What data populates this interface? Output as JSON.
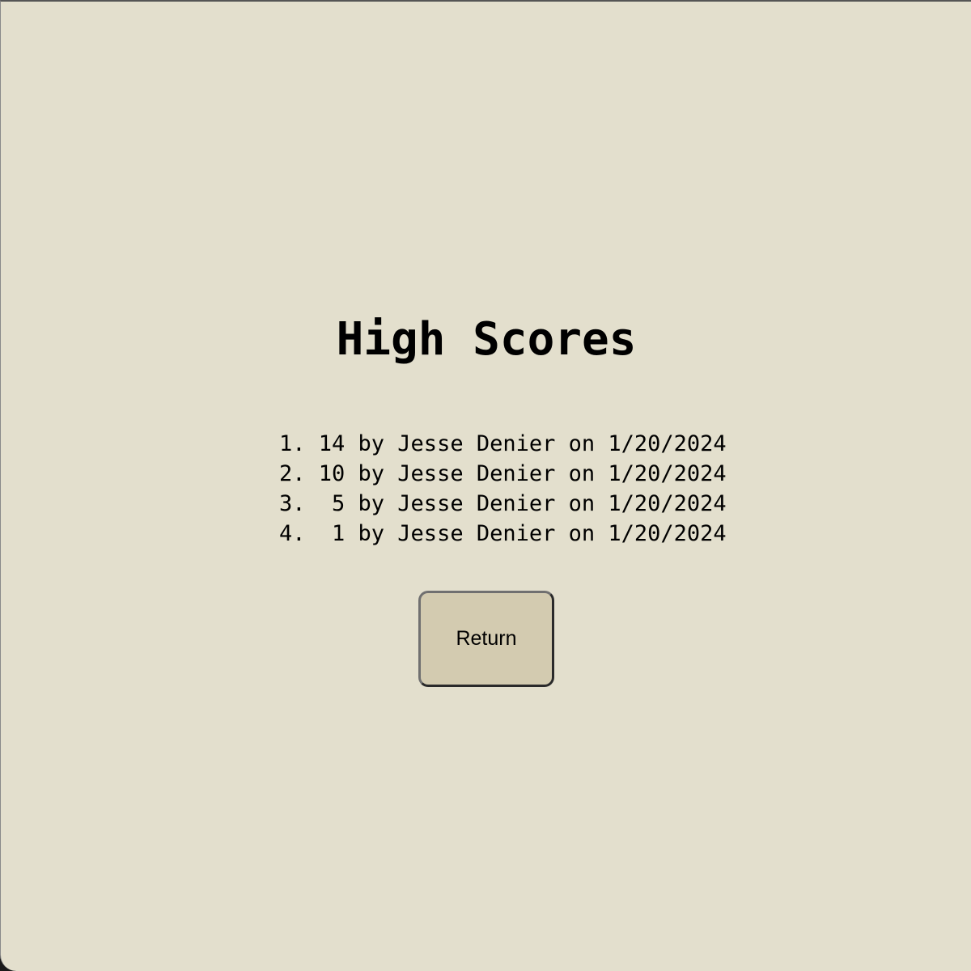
{
  "screen": {
    "title": "High Scores"
  },
  "scores": [
    {
      "line": "1. 14 by Jesse Denier on 1/20/2024"
    },
    {
      "line": "2. 10 by Jesse Denier on 1/20/2024"
    },
    {
      "line": "3.  5 by Jesse Denier on 1/20/2024"
    },
    {
      "line": "4.  1 by Jesse Denier on 1/20/2024"
    }
  ],
  "actions": {
    "return_label": "Return"
  },
  "colors": {
    "background": "#e3dfcd",
    "button": "#d3cbb0",
    "text": "#000000"
  }
}
